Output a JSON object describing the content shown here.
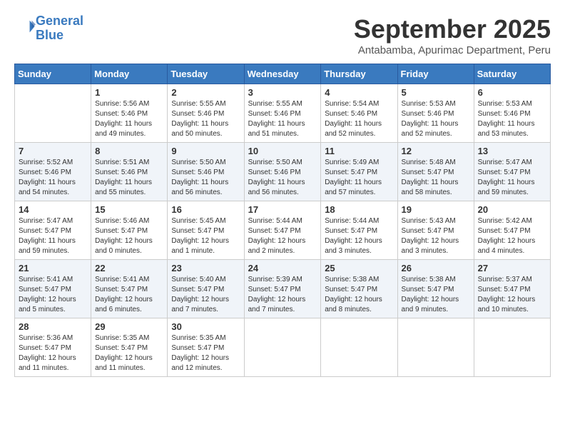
{
  "header": {
    "logo_line1": "General",
    "logo_line2": "Blue",
    "month_title": "September 2025",
    "subtitle": "Antabamba, Apurimac Department, Peru"
  },
  "columns": [
    "Sunday",
    "Monday",
    "Tuesday",
    "Wednesday",
    "Thursday",
    "Friday",
    "Saturday"
  ],
  "weeks": [
    [
      {
        "day": "",
        "info": ""
      },
      {
        "day": "1",
        "info": "Sunrise: 5:56 AM\nSunset: 5:46 PM\nDaylight: 11 hours\nand 49 minutes."
      },
      {
        "day": "2",
        "info": "Sunrise: 5:55 AM\nSunset: 5:46 PM\nDaylight: 11 hours\nand 50 minutes."
      },
      {
        "day": "3",
        "info": "Sunrise: 5:55 AM\nSunset: 5:46 PM\nDaylight: 11 hours\nand 51 minutes."
      },
      {
        "day": "4",
        "info": "Sunrise: 5:54 AM\nSunset: 5:46 PM\nDaylight: 11 hours\nand 52 minutes."
      },
      {
        "day": "5",
        "info": "Sunrise: 5:53 AM\nSunset: 5:46 PM\nDaylight: 11 hours\nand 52 minutes."
      },
      {
        "day": "6",
        "info": "Sunrise: 5:53 AM\nSunset: 5:46 PM\nDaylight: 11 hours\nand 53 minutes."
      }
    ],
    [
      {
        "day": "7",
        "info": "Sunrise: 5:52 AM\nSunset: 5:46 PM\nDaylight: 11 hours\nand 54 minutes."
      },
      {
        "day": "8",
        "info": "Sunrise: 5:51 AM\nSunset: 5:46 PM\nDaylight: 11 hours\nand 55 minutes."
      },
      {
        "day": "9",
        "info": "Sunrise: 5:50 AM\nSunset: 5:46 PM\nDaylight: 11 hours\nand 56 minutes."
      },
      {
        "day": "10",
        "info": "Sunrise: 5:50 AM\nSunset: 5:46 PM\nDaylight: 11 hours\nand 56 minutes."
      },
      {
        "day": "11",
        "info": "Sunrise: 5:49 AM\nSunset: 5:47 PM\nDaylight: 11 hours\nand 57 minutes."
      },
      {
        "day": "12",
        "info": "Sunrise: 5:48 AM\nSunset: 5:47 PM\nDaylight: 11 hours\nand 58 minutes."
      },
      {
        "day": "13",
        "info": "Sunrise: 5:47 AM\nSunset: 5:47 PM\nDaylight: 11 hours\nand 59 minutes."
      }
    ],
    [
      {
        "day": "14",
        "info": "Sunrise: 5:47 AM\nSunset: 5:47 PM\nDaylight: 11 hours\nand 59 minutes."
      },
      {
        "day": "15",
        "info": "Sunrise: 5:46 AM\nSunset: 5:47 PM\nDaylight: 12 hours\nand 0 minutes."
      },
      {
        "day": "16",
        "info": "Sunrise: 5:45 AM\nSunset: 5:47 PM\nDaylight: 12 hours\nand 1 minute."
      },
      {
        "day": "17",
        "info": "Sunrise: 5:44 AM\nSunset: 5:47 PM\nDaylight: 12 hours\nand 2 minutes."
      },
      {
        "day": "18",
        "info": "Sunrise: 5:44 AM\nSunset: 5:47 PM\nDaylight: 12 hours\nand 3 minutes."
      },
      {
        "day": "19",
        "info": "Sunrise: 5:43 AM\nSunset: 5:47 PM\nDaylight: 12 hours\nand 3 minutes."
      },
      {
        "day": "20",
        "info": "Sunrise: 5:42 AM\nSunset: 5:47 PM\nDaylight: 12 hours\nand 4 minutes."
      }
    ],
    [
      {
        "day": "21",
        "info": "Sunrise: 5:41 AM\nSunset: 5:47 PM\nDaylight: 12 hours\nand 5 minutes."
      },
      {
        "day": "22",
        "info": "Sunrise: 5:41 AM\nSunset: 5:47 PM\nDaylight: 12 hours\nand 6 minutes."
      },
      {
        "day": "23",
        "info": "Sunrise: 5:40 AM\nSunset: 5:47 PM\nDaylight: 12 hours\nand 7 minutes."
      },
      {
        "day": "24",
        "info": "Sunrise: 5:39 AM\nSunset: 5:47 PM\nDaylight: 12 hours\nand 7 minutes."
      },
      {
        "day": "25",
        "info": "Sunrise: 5:38 AM\nSunset: 5:47 PM\nDaylight: 12 hours\nand 8 minutes."
      },
      {
        "day": "26",
        "info": "Sunrise: 5:38 AM\nSunset: 5:47 PM\nDaylight: 12 hours\nand 9 minutes."
      },
      {
        "day": "27",
        "info": "Sunrise: 5:37 AM\nSunset: 5:47 PM\nDaylight: 12 hours\nand 10 minutes."
      }
    ],
    [
      {
        "day": "28",
        "info": "Sunrise: 5:36 AM\nSunset: 5:47 PM\nDaylight: 12 hours\nand 11 minutes."
      },
      {
        "day": "29",
        "info": "Sunrise: 5:35 AM\nSunset: 5:47 PM\nDaylight: 12 hours\nand 11 minutes."
      },
      {
        "day": "30",
        "info": "Sunrise: 5:35 AM\nSunset: 5:47 PM\nDaylight: 12 hours\nand 12 minutes."
      },
      {
        "day": "",
        "info": ""
      },
      {
        "day": "",
        "info": ""
      },
      {
        "day": "",
        "info": ""
      },
      {
        "day": "",
        "info": ""
      }
    ]
  ]
}
